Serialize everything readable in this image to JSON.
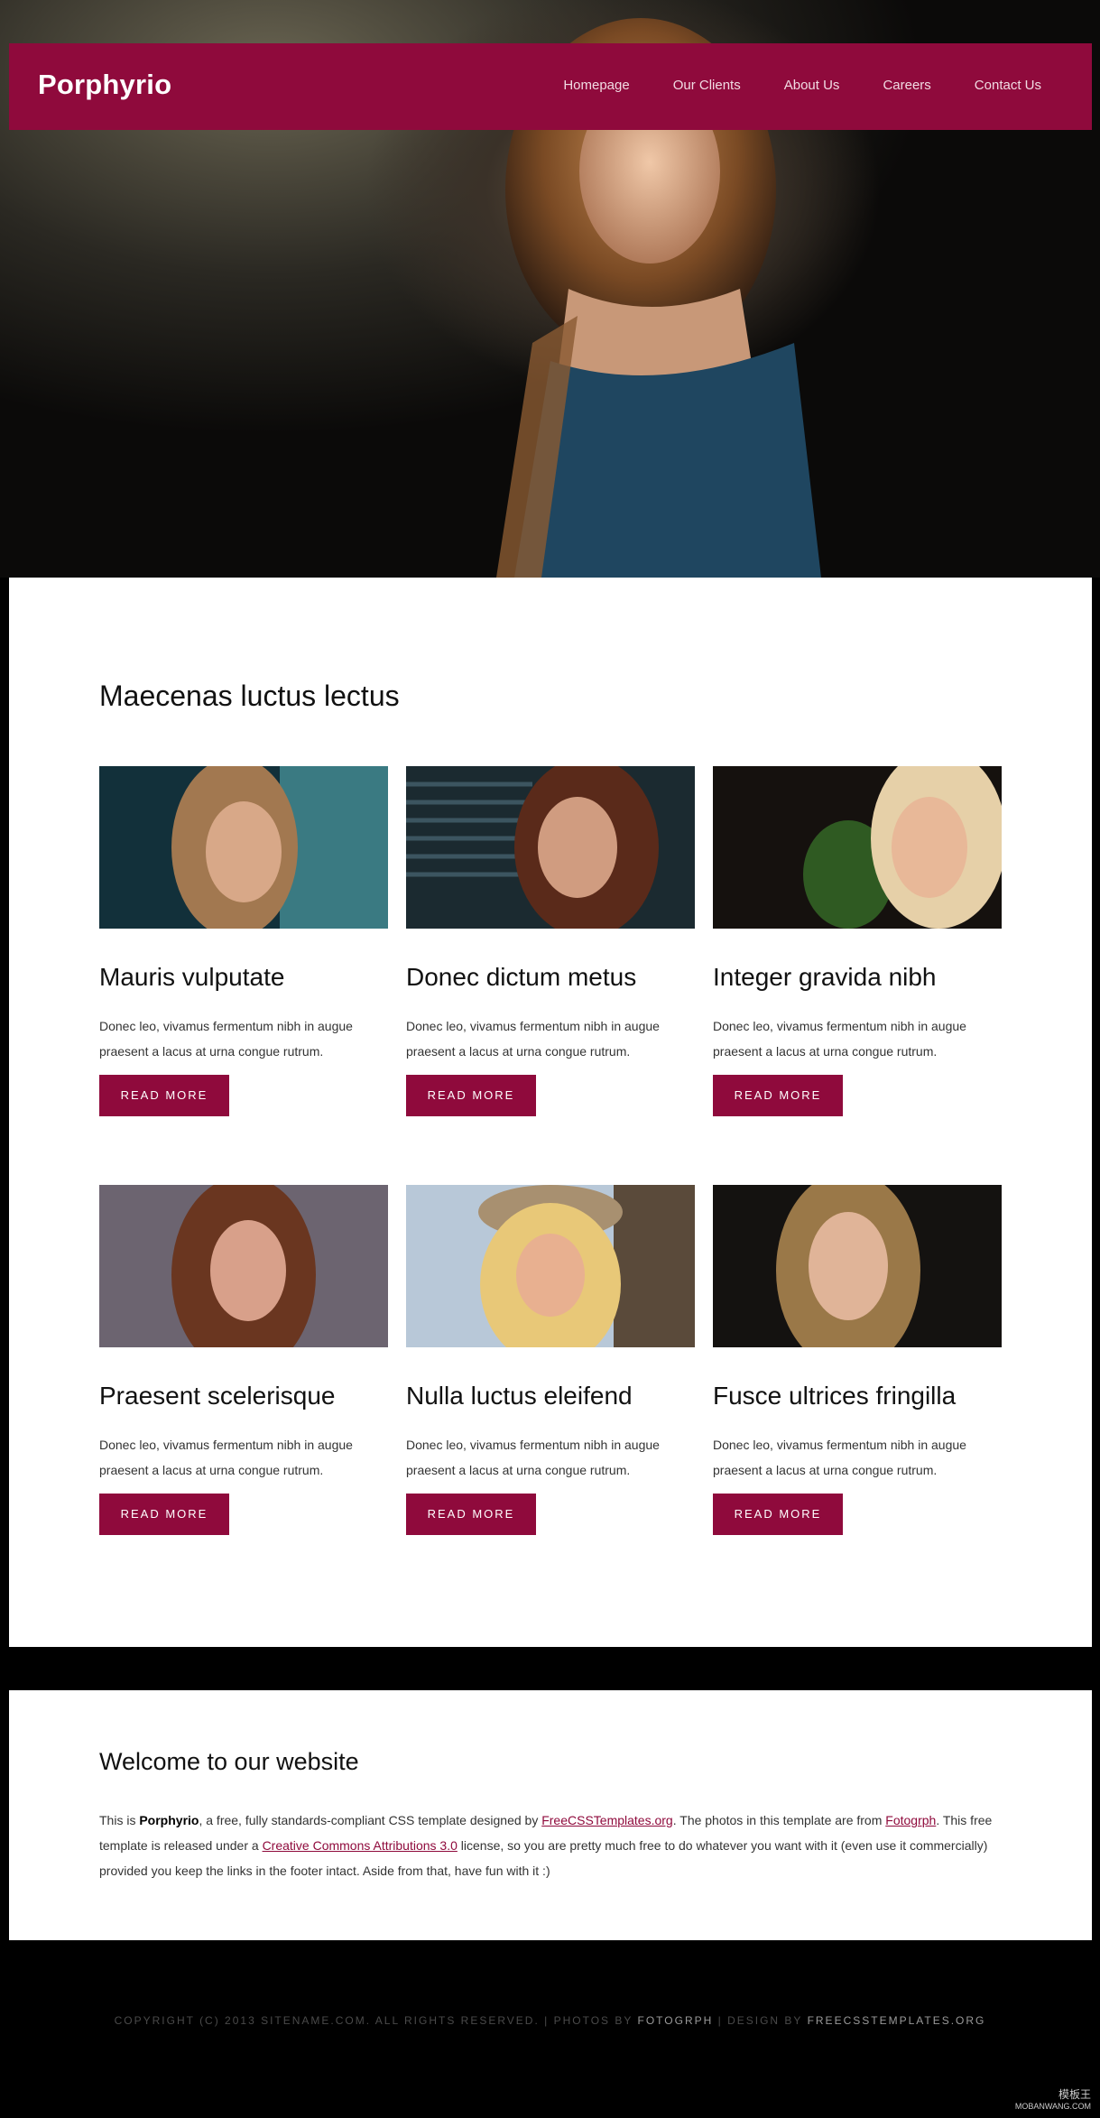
{
  "header": {
    "logo": "Porphyrio",
    "nav": [
      "Homepage",
      "Our Clients",
      "About Us",
      "Careers",
      "Contact Us"
    ]
  },
  "main": {
    "title": "Maecenas luctus lectus",
    "cards": [
      {
        "title": "Mauris vulputate",
        "text": "Donec leo, vivamus fermentum nibh in augue praesent a lacus at urna congue rutrum.",
        "button": "Read More"
      },
      {
        "title": "Donec dictum metus",
        "text": "Donec leo, vivamus fermentum nibh in augue praesent a lacus at urna congue rutrum.",
        "button": "Read More"
      },
      {
        "title": "Integer gravida nibh",
        "text": "Donec leo, vivamus fermentum nibh in augue praesent a lacus at urna congue rutrum.",
        "button": "Read More"
      },
      {
        "title": "Praesent scelerisque",
        "text": "Donec leo, vivamus fermentum nibh in augue praesent a lacus at urna congue rutrum.",
        "button": "Read More"
      },
      {
        "title": "Nulla luctus eleifend",
        "text": "Donec leo, vivamus fermentum nibh in augue praesent a lacus at urna congue rutrum.",
        "button": "Read More"
      },
      {
        "title": "Fusce ultrices fringilla",
        "text": "Donec leo, vivamus fermentum nibh in augue praesent a lacus at urna congue rutrum.",
        "button": "Read More"
      }
    ]
  },
  "welcome": {
    "title": "Welcome to our website",
    "p_intro": "This is ",
    "p_brand": "Porphyrio",
    "p_mid1": ", a free, fully standards-compliant CSS template designed by ",
    "link1": "FreeCSSTemplates.org",
    "p_mid2": ". The photos in this template are from ",
    "link2": "Fotogrph",
    "p_mid3": ". This free template is released under a ",
    "link3": "Creative Commons Attributions 3.0",
    "p_end": " license, so you are pretty much free to do whatever you want with it (even use it commercially) provided you keep the links in the footer intact. Aside from that, have fun with it :)"
  },
  "footer": {
    "copyright": "Copyright (c) 2013 Sitename.com. All rights reserved. | Photos by ",
    "photos_link": "Fotogrph",
    "design_prefix": " | Design by ",
    "design_link": "FreeCSSTemplates.org"
  },
  "watermark": {
    "title": "模板王",
    "url": "MOBANWANG.COM"
  },
  "colors": {
    "accent": "#8f0a3c",
    "background": "#000000",
    "panel": "#ffffff"
  }
}
